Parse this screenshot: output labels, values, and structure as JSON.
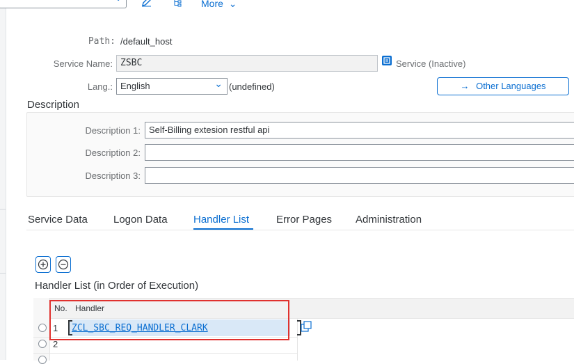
{
  "toolbar": {
    "more_label": "More",
    "icons": [
      "pencil-icon",
      "hierarchy-icon"
    ]
  },
  "header": {
    "path_label": "Path:",
    "path_value": "/default_host",
    "service_name_label": "Service Name:",
    "service_name_value": "ZSBC",
    "service_status": "Service (Inactive)",
    "lang_label": "Lang.:",
    "lang_value": "English",
    "lang_note": "(undefined)",
    "other_languages_label": "Other Languages"
  },
  "description": {
    "title": "Description",
    "fields": [
      {
        "label": "Description 1:",
        "value": "Self-Billing extesion restful api"
      },
      {
        "label": "Description 2:",
        "value": ""
      },
      {
        "label": "Description 3:",
        "value": ""
      }
    ]
  },
  "tabs": [
    {
      "label": "Service Data",
      "active": false
    },
    {
      "label": "Logon Data",
      "active": false
    },
    {
      "label": "Handler List",
      "active": true
    },
    {
      "label": "Error Pages",
      "active": false
    },
    {
      "label": "Administration",
      "active": false
    }
  ],
  "handler_list": {
    "title": "Handler List (in Order of Execution)",
    "columns": [
      "No.",
      "Handler"
    ],
    "rows": [
      {
        "no": "1",
        "handler": "ZCL_SBC_REQ_HANDLER_CLARK"
      },
      {
        "no": "2",
        "handler": ""
      }
    ]
  },
  "colors": {
    "accent": "#0a6ed1",
    "highlight_border": "#e0312e",
    "selected_row": "#d9e8f7"
  }
}
